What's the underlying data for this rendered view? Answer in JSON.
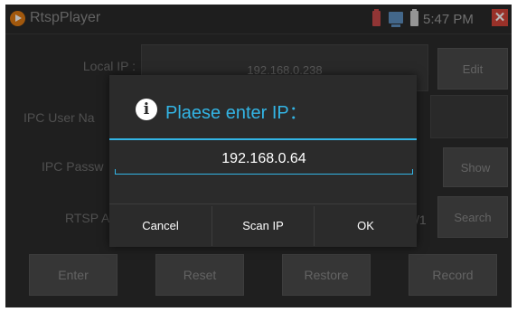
{
  "app": {
    "title": "RtspPlayer"
  },
  "status_bar": {
    "time": "5:47 PM",
    "close_glyph": "✕"
  },
  "form": {
    "local_ip_label": "Local IP :",
    "local_ip_value": "192.168.0.238",
    "edit_label": "Edit",
    "ipc_user_label": "IPC User Na",
    "ipc_password_label": "IPC Passw",
    "show_label": "Show",
    "rtsp_label": "RTSP A",
    "rtsp_value_tail": "/1",
    "search_label": "Search"
  },
  "bottom_bar": {
    "enter": "Enter",
    "reset": "Reset",
    "restore": "Restore",
    "record": "Record"
  },
  "dialog": {
    "info_glyph": "i",
    "title": "Plaese enter IP：",
    "ip_value": "192.168.0.64",
    "cancel": "Cancel",
    "scan_ip": "Scan IP",
    "ok": "OK"
  },
  "colors": {
    "accent": "#33b5e5",
    "app_icon": "#e07a12",
    "close": "#d4453a"
  },
  "icons": {
    "app": "play-icon",
    "dialog": "info-icon"
  }
}
